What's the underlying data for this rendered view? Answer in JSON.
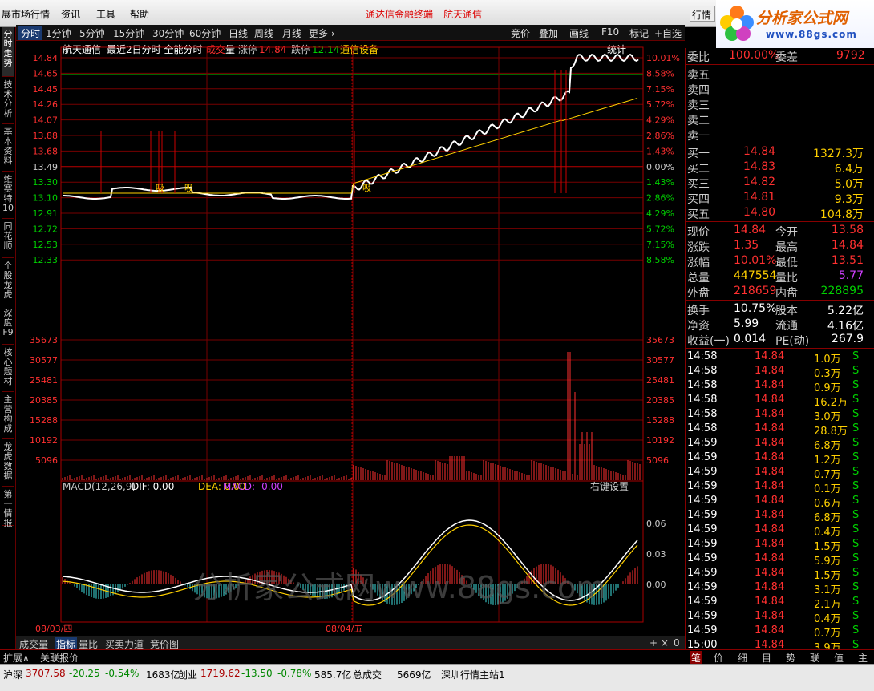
{
  "menu": {
    "items": [
      "展市场行情",
      "资讯",
      "工具",
      "帮助"
    ],
    "center1": "通达信金融终端",
    "center2": "航天通信",
    "hq_button": "行情"
  },
  "logo": {
    "name": "分析家公式网",
    "url": "www.88gs.com"
  },
  "sidetabs": [
    "分时走势",
    "技术分析",
    "基本资料",
    "维赛特10",
    "同花顺",
    "个股龙虎",
    "深度F9",
    "核心题材",
    "主营构成",
    "龙虎数据",
    "第一情报"
  ],
  "toolbar": {
    "left": [
      "分时",
      "1分钟",
      "5分钟",
      "15分钟",
      "30分钟",
      "60分钟",
      "日线",
      "周线",
      "月线",
      "更多 ›"
    ],
    "right": [
      "竞价",
      "叠加",
      "画线",
      "F10",
      "标记",
      "+自选"
    ]
  },
  "chart": {
    "stock": "航天通信",
    "mode_label": "最近2日分时 全能分时",
    "vol_label_a": "成交",
    "vol_label_b": "量",
    "up_limit_label": "涨停",
    "up_limit": "14.84",
    "down_limit_label": "跌停",
    "down_limit": "12.14",
    "sector": "通信设备",
    "stat": "统计",
    "price_ticks": [
      "14.84",
      "14.65",
      "14.45",
      "14.26",
      "14.07",
      "13.88",
      "13.68",
      "13.49",
      "13.30",
      "13.10",
      "12.91",
      "12.72",
      "12.53",
      "12.33"
    ],
    "pct_ticks": [
      "10.01%",
      "8.58%",
      "7.15%",
      "5.72%",
      "4.29%",
      "2.86%",
      "1.43%",
      "0.00%",
      "1.43%",
      "2.86%",
      "4.29%",
      "5.72%",
      "7.15%",
      "8.58%"
    ],
    "vol_ticks": [
      "35673",
      "30577",
      "25481",
      "20385",
      "15288",
      "10192",
      "5096"
    ],
    "macd_label": "MACD(12,26,9)",
    "dif": "DIF: 0.00",
    "dea": "DEA: 0.00",
    "macd": "MACD: -0.00",
    "macd_setting": "右键设置",
    "macd_ticks": [
      "0.06",
      "0.03",
      "0.00"
    ],
    "dates": [
      "08/03/四",
      "08/04/五"
    ],
    "watermark": "分析家公式网www.88gs.com",
    "marks": [
      "吸",
      "吸",
      "吸"
    ]
  },
  "bottabs": [
    "成交量",
    "指标",
    "量比",
    "买卖力道",
    "竞价图"
  ],
  "bottabs_right": [
    "+",
    "×",
    "0"
  ],
  "expand": [
    "扩展∧",
    "关联报价"
  ],
  "panel": {
    "weibi_label": "委比",
    "weibi": "100.00%",
    "weicha_label": "委差",
    "weicha": "9792",
    "sells": [
      "卖五",
      "卖四",
      "卖三",
      "卖二",
      "卖一"
    ],
    "buys": [
      {
        "l": "买一",
        "p": "14.84",
        "v": "1327.3万"
      },
      {
        "l": "买二",
        "p": "14.83",
        "v": "6.4万"
      },
      {
        "l": "买三",
        "p": "14.82",
        "v": "5.0万"
      },
      {
        "l": "买四",
        "p": "14.81",
        "v": "9.3万"
      },
      {
        "l": "买五",
        "p": "14.80",
        "v": "104.8万"
      }
    ],
    "q": [
      {
        "l1": "现价",
        "v1": "14.84",
        "c1": "up",
        "l2": "今开",
        "v2": "13.58",
        "c2": "up"
      },
      {
        "l1": "涨跌",
        "v1": "1.35",
        "c1": "up",
        "l2": "最高",
        "v2": "14.84",
        "c2": "up"
      },
      {
        "l1": "涨幅",
        "v1": "10.01%",
        "c1": "up",
        "l2": "最低",
        "v2": "13.51",
        "c2": "up"
      },
      {
        "l1": "总量",
        "v1": "447554",
        "c1": "yel",
        "l2": "量比",
        "v2": "5.77",
        "c2": "pur"
      },
      {
        "l1": "外盘",
        "v1": "218659",
        "c1": "up",
        "l2": "内盘",
        "v2": "228895",
        "c2": "dn"
      }
    ],
    "f": [
      {
        "l1": "换手",
        "v1": "10.75%",
        "l2": "股本",
        "v2": "5.22亿"
      },
      {
        "l1": "净资",
        "v1": "5.99",
        "l2": "流通",
        "v2": "4.16亿"
      },
      {
        "l1": "收益(一)",
        "v1": "0.014",
        "l2": "PE(动)",
        "v2": "267.9"
      }
    ],
    "ticks": [
      [
        "14:58",
        "14.84",
        "1.0万",
        "S"
      ],
      [
        "14:58",
        "14.84",
        "0.3万",
        "S"
      ],
      [
        "14:58",
        "14.84",
        "0.9万",
        "S"
      ],
      [
        "14:58",
        "14.84",
        "16.2万",
        "S"
      ],
      [
        "14:58",
        "14.84",
        "3.0万",
        "S"
      ],
      [
        "14:58",
        "14.84",
        "28.8万",
        "S"
      ],
      [
        "14:59",
        "14.84",
        "6.8万",
        "S"
      ],
      [
        "14:59",
        "14.84",
        "1.2万",
        "S"
      ],
      [
        "14:59",
        "14.84",
        "0.7万",
        "S"
      ],
      [
        "14:59",
        "14.84",
        "0.1万",
        "S"
      ],
      [
        "14:59",
        "14.84",
        "0.6万",
        "S"
      ],
      [
        "14:59",
        "14.84",
        "6.8万",
        "S"
      ],
      [
        "14:59",
        "14.84",
        "0.4万",
        "S"
      ],
      [
        "14:59",
        "14.84",
        "1.5万",
        "S"
      ],
      [
        "14:59",
        "14.84",
        "5.9万",
        "S"
      ],
      [
        "14:59",
        "14.84",
        "1.5万",
        "S"
      ],
      [
        "14:59",
        "14.84",
        "3.1万",
        "S"
      ],
      [
        "14:59",
        "14.84",
        "2.1万",
        "S"
      ],
      [
        "14:59",
        "14.84",
        "0.4万",
        "S"
      ],
      [
        "14:59",
        "14.84",
        "0.7万",
        "S"
      ],
      [
        "15:00",
        "14.84",
        "3.9万",
        "S"
      ]
    ]
  },
  "rtabs": [
    "笔",
    "价",
    "细",
    "目",
    "势",
    "联",
    "值",
    "主"
  ],
  "status": {
    "sh_label": "沪深",
    "sh_val": "3707.58",
    "sh_chg": "-20.25",
    "sh_pct": "-0.54%",
    "sh_amt": "1683亿",
    "cy_label": "创业",
    "cy_val": "1719.62",
    "cy_chg": "-13.50",
    "cy_pct": "-0.78%",
    "cy_amt": "585.7亿",
    "total_label": "总成交",
    "total_val": "5669亿",
    "server": "深圳行情主站1"
  }
}
